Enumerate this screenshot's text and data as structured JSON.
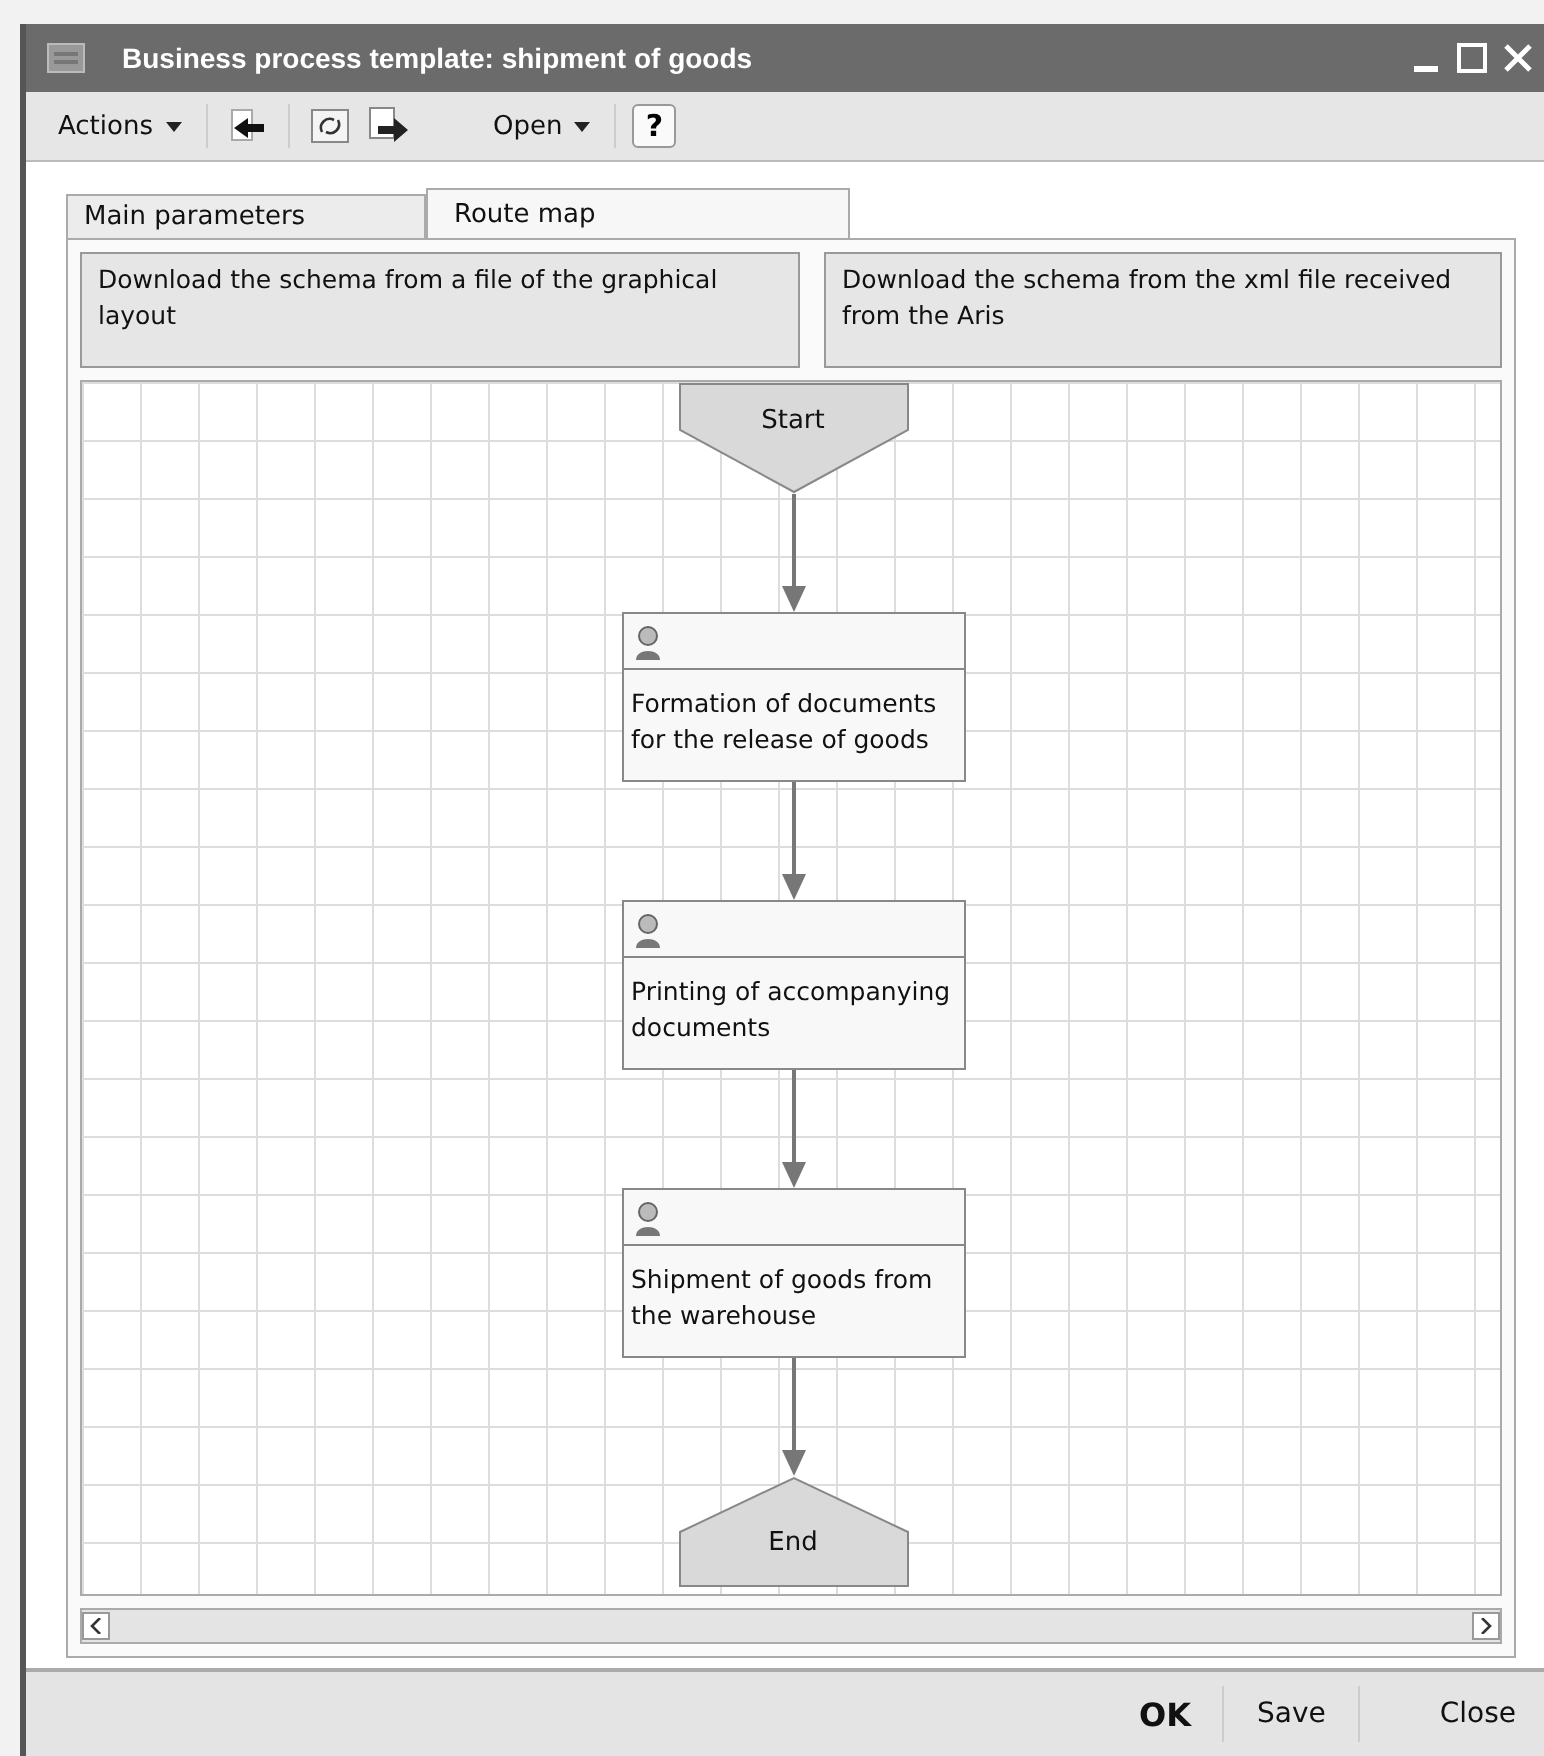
{
  "window": {
    "title": "Business process template: shipment of goods"
  },
  "toolbar": {
    "menus": [
      "Actions",
      "Open"
    ],
    "help": "?"
  },
  "tabs": [
    {
      "label": "Main parameters",
      "selected": false
    },
    {
      "label": "Route map",
      "selected": true
    }
  ],
  "schema_buttons": [
    "Download the schema from a file of the graphical layout",
    "Download the schema from the xml file received from the Aris"
  ],
  "diagram": {
    "nodes": [
      {
        "kind": "start",
        "label": "Start"
      },
      {
        "kind": "task",
        "label": "Formation of documents for the release of goods"
      },
      {
        "kind": "task",
        "label": "Printing of accompanying documents"
      },
      {
        "kind": "task",
        "label": "Shipment of goods from the warehouse"
      },
      {
        "kind": "end",
        "label": "End"
      }
    ]
  },
  "footer_buttons": [
    {
      "label": "OK",
      "default": true
    },
    {
      "label": "Save",
      "default": false
    },
    {
      "label": "Close",
      "default": false
    }
  ]
}
